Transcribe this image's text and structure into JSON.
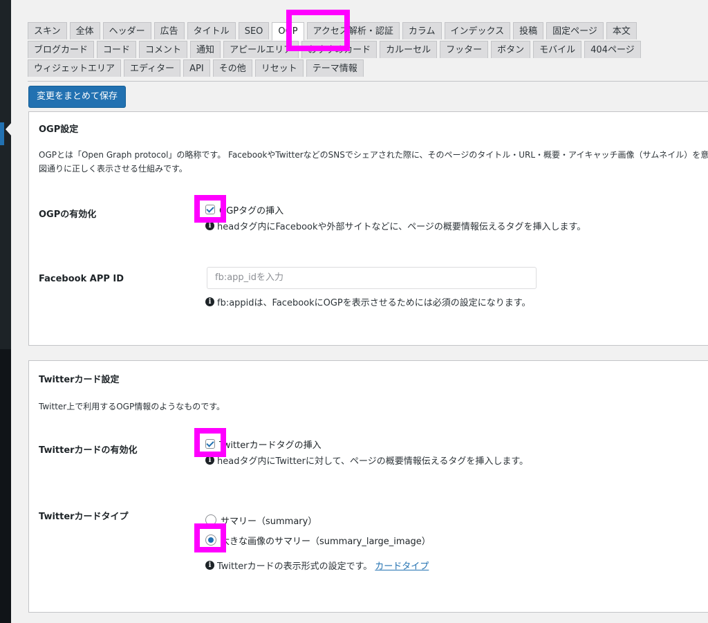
{
  "tabs": {
    "row1": [
      "スキン",
      "全体",
      "ヘッダー",
      "広告",
      "タイトル",
      "SEO",
      "OGP",
      "アクセス解析・認証",
      "カラム",
      "インデックス",
      "投稿",
      "固定ページ",
      "本文"
    ],
    "row2": [
      "ブログカード",
      "コード",
      "コメント",
      "通知",
      "アピールエリア",
      "おすすめカード",
      "カルーセル",
      "フッター",
      "ボタン",
      "モバイル",
      "404ページ"
    ],
    "row3": [
      "ウィジェットエリア",
      "エディター",
      "API",
      "その他",
      "リセット",
      "テーマ情報"
    ],
    "active": "OGP"
  },
  "save_button": "変更をまとめて保存",
  "ogp_panel": {
    "title": "OGP設定",
    "description": "OGPとは「Open Graph protocol」の略称です。 FacebookやTwitterなどのSNSでシェアされた際に、そのページのタイトル・URL・概要・アイキャッチ画像（サムネイル）を意図通りに正しく表示させる仕組みです。",
    "enable_label": "OGPの有効化",
    "enable_checkbox": "OGPタグの挿入",
    "enable_checked": true,
    "enable_hint": "headタグ内にFacebookや外部サイトなどに、ページの概要情報伝えるタグを挿入します。",
    "appid_label": "Facebook APP ID",
    "appid_placeholder": "fb:app_idを入力",
    "appid_hint": "fb:appidは、FacebookにOGPを表示させるためには必須の設定になります。"
  },
  "twitter_panel": {
    "title": "Twitterカード設定",
    "description": "Twitter上で利用するOGP情報のようなものです。",
    "enable_label": "Twitterカードの有効化",
    "enable_checkbox": "Twitterカードタグの挿入",
    "enable_checked": true,
    "enable_hint": "headタグ内にTwitterに対して、ページの概要情報伝えるタグを挿入します。",
    "type_label": "Twitterカードタイプ",
    "type_options": [
      "サマリー（summary）",
      "大きな画像のサマリー（summary_large_image）"
    ],
    "type_selected": "大きな画像のサマリー（summary_large_image）",
    "type_hint": "Twitterカードの表示形式の設定です。",
    "type_link": "カードタイプ"
  },
  "colors": {
    "highlight": "#ff00ff",
    "primary": "#2271b1",
    "sidebar": "#1d2327"
  },
  "icons": [
    "info-icon",
    "checkbox-checked-icon",
    "radio-selected-icon"
  ]
}
